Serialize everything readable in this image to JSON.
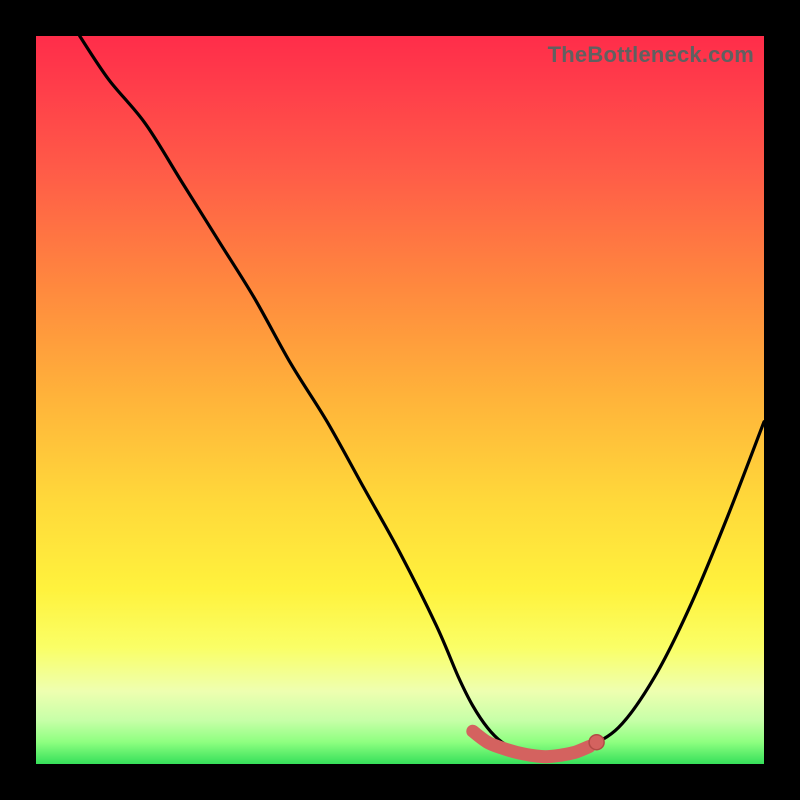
{
  "watermark": "TheBottleneck.com",
  "colors": {
    "frame": "#000000",
    "curve": "#000000",
    "marker": "#d4625f",
    "marker_stroke": "#b24b46"
  },
  "chart_data": {
    "type": "line",
    "title": "",
    "xlabel": "",
    "ylabel": "",
    "xlim": [
      0,
      100
    ],
    "ylim": [
      0,
      100
    ],
    "grid": false,
    "legend": false,
    "series": [
      {
        "name": "bottleneck-curve",
        "x": [
          6,
          10,
          15,
          20,
          25,
          30,
          35,
          40,
          45,
          50,
          55,
          58,
          60,
          62,
          64,
          66,
          68,
          70,
          72,
          75,
          80,
          85,
          90,
          95,
          100
        ],
        "y": [
          100,
          94,
          88,
          80,
          72,
          64,
          55,
          47,
          38,
          29,
          19,
          12,
          8,
          5,
          3,
          2,
          1,
          1,
          1,
          2,
          5,
          12,
          22,
          34,
          47
        ]
      }
    ],
    "highlight": {
      "name": "optimal-range",
      "x": [
        60,
        62,
        64,
        66,
        68,
        70,
        72,
        74,
        76
      ],
      "y": [
        4.5,
        3.0,
        2.2,
        1.6,
        1.2,
        1.0,
        1.2,
        1.6,
        2.4
      ]
    },
    "marker_point": {
      "x": 77,
      "y": 3.0
    }
  }
}
